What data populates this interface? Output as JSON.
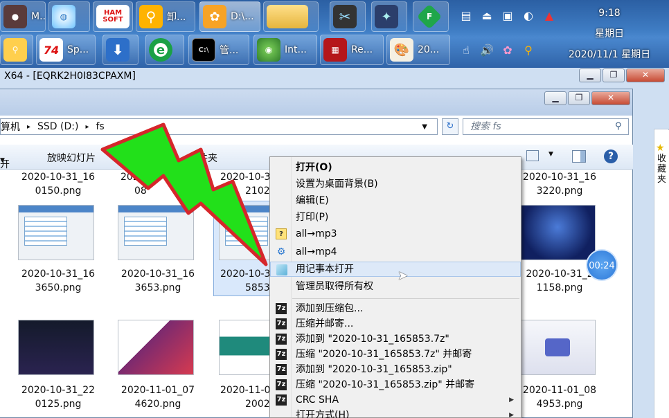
{
  "taskbar": {
    "row1": [
      {
        "label": "M..."
      },
      {
        "label": ""
      },
      {
        "label": "HAM SOFT"
      },
      {
        "label": "卸..."
      },
      {
        "label": "D:\\..."
      },
      {
        "label": ""
      },
      {
        "label": ""
      },
      {
        "label": ""
      },
      {
        "label": "F"
      }
    ],
    "row2": [
      {
        "label": ""
      },
      {
        "label": "Sp..."
      },
      {
        "label": ""
      },
      {
        "label": ""
      },
      {
        "label": "管..."
      },
      {
        "label": "Int..."
      },
      {
        "label": "Re..."
      },
      {
        "label": "20..."
      }
    ],
    "clock": {
      "time": "9:18",
      "weekday": "星期日",
      "date": "2020/11/1 星期日"
    }
  },
  "back_window": {
    "title": "X64 - [EQRK2H0I83CPAXM]",
    "side_label": "收藏夹"
  },
  "explorer": {
    "breadcrumb": [
      "算机",
      "SSD (D:)",
      "fs"
    ],
    "search_placeholder": "搜索 fs",
    "toolbar": {
      "open": "开",
      "slideshow": "放映幻灯片",
      "new_folder": "文件夹"
    },
    "files": [
      {
        "line1": "2020-10-31_16",
        "line2": "0150.png"
      },
      {
        "line1": "2020",
        "line2": "08"
      },
      {
        "line1": "2020-10-3",
        "line2": "2102."
      },
      {
        "line1": "2020-10-31_16",
        "line2": "3220.png"
      },
      {
        "line1": "2020-10-31_16",
        "line2": "3650.png"
      },
      {
        "line1": "2020-10-31_16",
        "line2": "3653.png"
      },
      {
        "line1": "2020-10-3",
        "line2": "5853.p"
      },
      {
        "line1": "2020-10-31_2",
        "line2": "1158.png"
      },
      {
        "line1": "2020-10-31_22",
        "line2": "0125.png"
      },
      {
        "line1": "2020-11-01_07",
        "line2": "4620.png"
      },
      {
        "line1": "2020-11-0",
        "line2": "2002."
      },
      {
        "line1": "2020-11-01_08",
        "line2": "4953.png"
      }
    ]
  },
  "context_menu": {
    "items": [
      {
        "label": "打开(O)"
      },
      {
        "label": "设置为桌面背景(B)"
      },
      {
        "label": "编辑(E)"
      },
      {
        "label": "打印(P)"
      },
      {
        "label": "all→mp3"
      },
      {
        "label": "all→mp4"
      },
      {
        "label": "用记事本打开"
      },
      {
        "label": "管理员取得所有权"
      },
      {
        "label": "添加到压缩包..."
      },
      {
        "label": "压缩并邮寄..."
      },
      {
        "label": "添加到 \"2020-10-31_165853.7z\""
      },
      {
        "label": "压缩 \"2020-10-31_165853.7z\" 并邮寄"
      },
      {
        "label": "添加到 \"2020-10-31_165853.zip\""
      },
      {
        "label": "压缩 \"2020-10-31_165853.zip\" 并邮寄"
      },
      {
        "label": "CRC SHA"
      },
      {
        "label": "打开方式(H)"
      }
    ]
  },
  "timer": {
    "value": "00:24"
  }
}
